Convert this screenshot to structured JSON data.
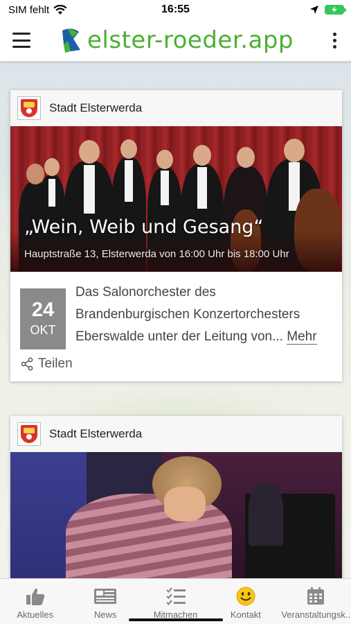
{
  "status_bar": {
    "carrier": "SIM fehlt",
    "time": "16:55"
  },
  "app_bar": {
    "brand": "elster-roeder.app"
  },
  "feed": {
    "cards": [
      {
        "source": "Stadt Elsterwerda",
        "image_title": "„Wein, Weib und Gesang“",
        "image_subtitle": "Hauptstraße 13, Elsterwerda von 16:00 Uhr bis 18:00 Uhr",
        "date_day": "24",
        "date_month": "OKT",
        "description": "Das Salonorchester des Brandenburgischen Konzertorchesters Eberswalde unter der Leitung von...",
        "more_label": "Mehr",
        "share_label": "Teilen"
      },
      {
        "source": "Stadt Elsterwerda"
      }
    ]
  },
  "tabbar": {
    "tabs": [
      {
        "label": "Aktuelles",
        "icon": "thumbs-up-icon"
      },
      {
        "label": "News",
        "icon": "newspaper-icon"
      },
      {
        "label": "Mitmachen",
        "icon": "checklist-icon"
      },
      {
        "label": "Kontakt",
        "icon": "smiley-icon"
      },
      {
        "label": "Veranstaltungsk...",
        "icon": "calendar-icon"
      }
    ]
  },
  "colors": {
    "brand_green": "#4caf33",
    "brand_blue": "#1a5fa8",
    "battery_green": "#34c759",
    "kontakt_yellow": "#f5c518",
    "date_box_gray": "#8a8a8a"
  }
}
